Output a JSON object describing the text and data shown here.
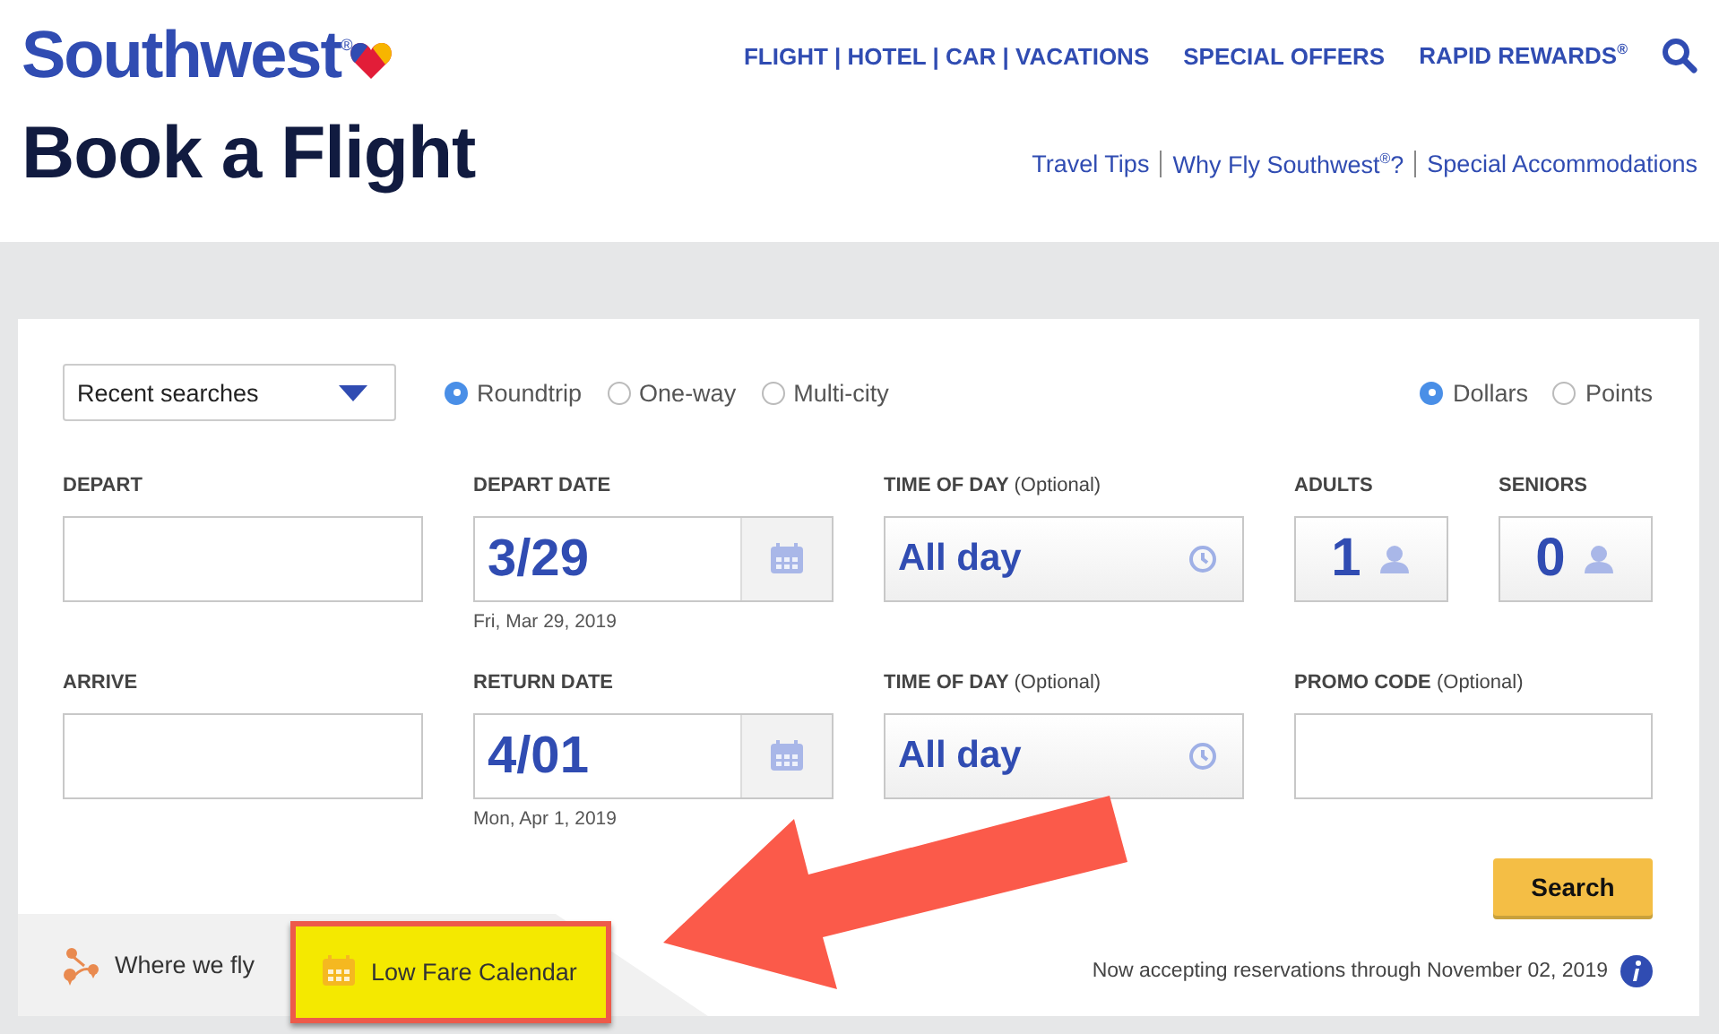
{
  "header": {
    "logo": "Southwest",
    "logo_mark": "®",
    "nav": [
      "FLIGHT | HOTEL | CAR | VACATIONS",
      "SPECIAL OFFERS",
      "RAPID REWARDS$^{®}$"
    ],
    "title": "Book a Flight",
    "links": [
      "Travel Tips",
      "Why Fly Southwest$^{®}$?",
      "Special Accommodations"
    ]
  },
  "form": {
    "recent_searches": "Recent searches",
    "trip_types": [
      {
        "label": "Roundtrip",
        "selected": true
      },
      {
        "label": "One-way",
        "selected": false
      },
      {
        "label": "Multi-city",
        "selected": false
      }
    ],
    "currency": [
      {
        "label": "Dollars",
        "selected": true
      },
      {
        "label": "Points",
        "selected": false
      }
    ],
    "rows": [
      [
        {
          "kind": "text",
          "label": "DEPART"
        },
        {
          "kind": "date",
          "label": "DEPART DATE",
          "value": "3/29",
          "note": "Fri, Mar 29, 2019"
        },
        {
          "kind": "time",
          "label": "TIME OF DAY",
          "optional": "(Optional)",
          "value": "All day"
        },
        {
          "kind": "count",
          "label": "ADULTS",
          "value": "1"
        },
        {
          "kind": "count",
          "label": "SENIORS",
          "value": "0"
        }
      ],
      [
        {
          "kind": "text",
          "label": "ARRIVE"
        },
        {
          "kind": "date",
          "label": "RETURN DATE",
          "value": "4/01",
          "note": "Mon, Apr 1, 2019"
        },
        {
          "kind": "time",
          "label": "TIME OF DAY",
          "optional": "(Optional)",
          "value": "All day"
        },
        {
          "kind": "promo",
          "label": "PROMO CODE",
          "optional": "(Optional)"
        }
      ]
    ],
    "search_button": "Search",
    "footer_links": [
      {
        "kind": "map",
        "label": "Where we fly",
        "highlighted": false
      },
      {
        "kind": "calendar",
        "label": "Low Fare Calendar",
        "highlighted": true
      }
    ],
    "notice": "Now accepting reservations through November 02, 2019"
  }
}
